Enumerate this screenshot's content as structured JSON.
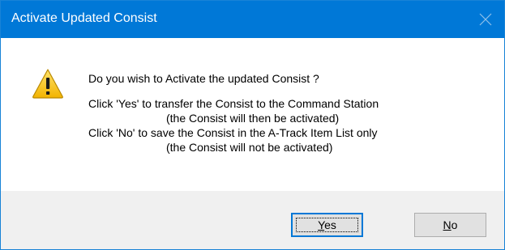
{
  "window": {
    "title": "Activate Updated Consist",
    "titlebar_color": "#0078d7",
    "close_icon": "close-icon"
  },
  "message": {
    "icon": "warning-icon",
    "question": "Do you wish to Activate the updated Consist ?",
    "yes_line": "Click 'Yes' to transfer the Consist to the Command Station",
    "yes_note": "(the Consist will then be activated)",
    "no_line": "Click 'No' to save the Consist in the A-Track Item List only",
    "no_note": "(the Consist will not be activated)"
  },
  "buttons": {
    "yes": {
      "mnemonic": "Y",
      "rest": "es",
      "is_default": true
    },
    "no": {
      "mnemonic": "N",
      "rest": "o",
      "is_default": false
    }
  }
}
